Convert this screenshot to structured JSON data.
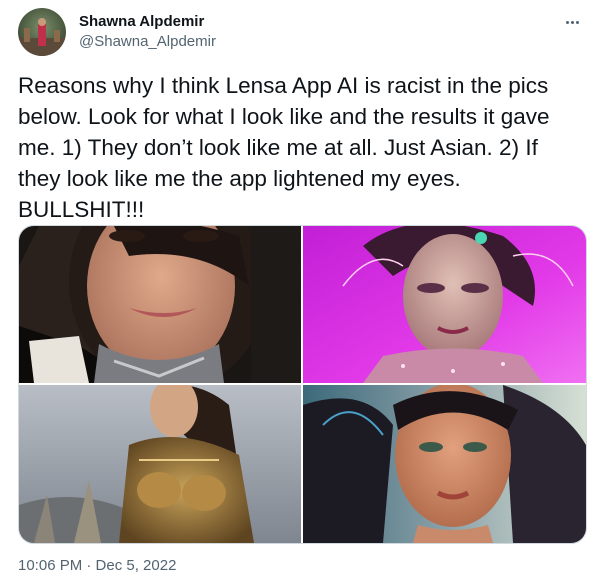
{
  "author": {
    "display_name": "Shawna Alpdemir",
    "handle": "@Shawna_Alpdemir",
    "avatar_icon": "profile-photo"
  },
  "menu_icon": "more-horizontal-icon",
  "tweet": {
    "text": "Reasons why I think Lensa App AI is racist in the pics below. Look for what I look like and the results it gave me. 1) They don’t look like me at all. Just Asian. 2) If they look like me the app lightened my eyes. BULLSHIT!!!",
    "timestamp": "10:06 PM · Dec 5, 2022"
  },
  "media": {
    "photo_count": 4,
    "photos": [
      "selfie-photo",
      "ai-portrait-pink-glitter",
      "ai-portrait-warrior-armor",
      "ai-portrait-painted-face"
    ]
  },
  "colors": {
    "text": "#0f1419",
    "secondary": "#536471",
    "border": "#cfd9de"
  }
}
